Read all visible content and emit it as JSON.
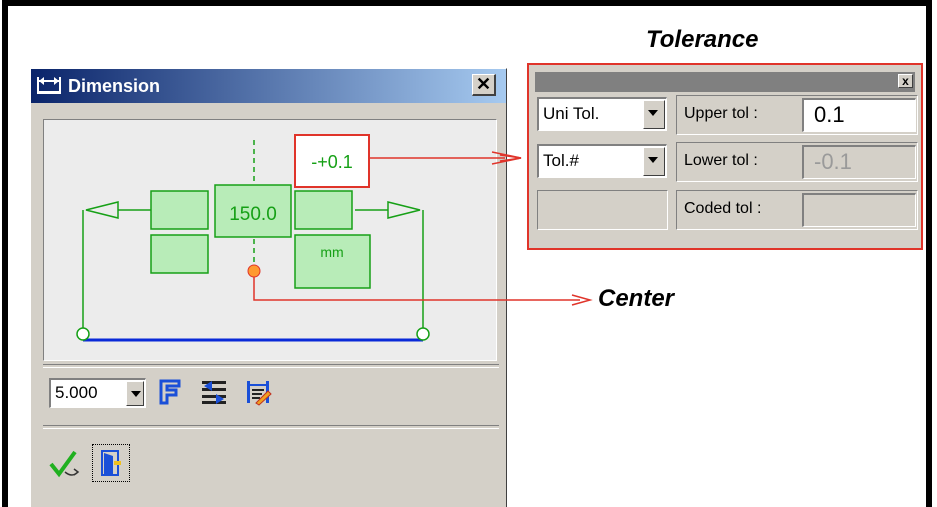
{
  "dialog": {
    "title": "Dimension",
    "close_glyph": "✕",
    "dimension_value": "150.0",
    "tolerance_display": "-+0.1",
    "unit_label": "mm",
    "precision_select": "5.000",
    "icons": {
      "title": "dimension-icon",
      "font": "font-icon",
      "swap": "arrow-swap-icon",
      "settings": "dimension-settings-icon",
      "ok": "checkmark-icon",
      "exit": "exit-door-icon"
    }
  },
  "tolerance_panel": {
    "heading": "Tolerance",
    "close_glyph": "x",
    "type_select": "Uni Tol.",
    "format_select": "Tol.#",
    "upper_label": "Upper tol :",
    "upper_value": "0.1",
    "lower_label": "Lower tol :",
    "lower_value": "-0.1",
    "coded_label": "Coded tol :"
  },
  "callouts": {
    "center": "Center"
  },
  "colors": {
    "callout": "#e0342a",
    "annotation_green": "#16a016",
    "baseline_blue": "#0a2ad8",
    "title_gradient_start": "#0a246a",
    "title_gradient_end": "#a6caf0"
  }
}
